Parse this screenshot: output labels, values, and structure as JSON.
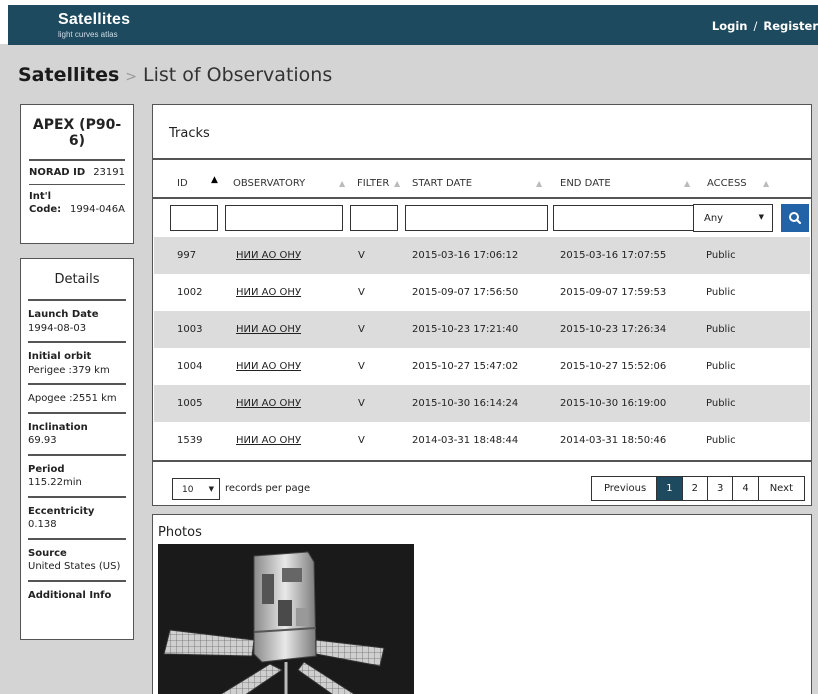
{
  "navbar": {
    "brand_title": "Satellites",
    "brand_subtitle": "light curves atlas",
    "login": "Login",
    "separator": "/",
    "register": "Register"
  },
  "breadcrumb": {
    "root": "Satellites",
    "separator": ">",
    "current": "List of Observations"
  },
  "satellite": {
    "name": "APEX (P90-6)",
    "norad_label": "NORAD ID",
    "norad_value": "23191",
    "intl_label_1": "Int'l",
    "intl_label_2": "Code:",
    "intl_value": "1994-046A"
  },
  "details": {
    "title": "Details",
    "launch_label": "Launch Date",
    "launch_value": "1994-08-03",
    "orbit_label": "Initial orbit",
    "perigee": "Perigee :379 km",
    "apogee": "Apogee :2551 km",
    "inclination_label": "Inclination",
    "inclination_value": "69.93",
    "period_label": "Period",
    "period_value": "115.22min",
    "eccentricity_label": "Eccentricity",
    "eccentricity_value": "0.138",
    "source_label": "Source",
    "source_value": "United States (US)",
    "additional_info": "Additional Info"
  },
  "tracks": {
    "title": "Tracks",
    "columns": {
      "id": "ID",
      "observatory": "OBSERVATORY",
      "filter": "FILTER",
      "start_date": "START DATE",
      "end_date": "END DATE",
      "access": "ACCESS"
    },
    "sorted_column": "ID",
    "access_filter": "Any",
    "rows": [
      {
        "id": "997",
        "observatory": "НИИ АО ОНУ",
        "filter": "V",
        "start": "2015-03-16 17:06:12",
        "end": "2015-03-16 17:07:55",
        "access": "Public"
      },
      {
        "id": "1002",
        "observatory": "НИИ АО ОНУ",
        "filter": "V",
        "start": "2015-09-07 17:56:50",
        "end": "2015-09-07 17:59:53",
        "access": "Public"
      },
      {
        "id": "1003",
        "observatory": "НИИ АО ОНУ",
        "filter": "V",
        "start": "2015-10-23 17:21:40",
        "end": "2015-10-23 17:26:34",
        "access": "Public"
      },
      {
        "id": "1004",
        "observatory": "НИИ АО ОНУ",
        "filter": "V",
        "start": "2015-10-27 15:47:02",
        "end": "2015-10-27 15:52:06",
        "access": "Public"
      },
      {
        "id": "1005",
        "observatory": "НИИ АО ОНУ",
        "filter": "V",
        "start": "2015-10-30 16:14:24",
        "end": "2015-10-30 16:19:00",
        "access": "Public"
      },
      {
        "id": "1539",
        "observatory": "НИИ АО ОНУ",
        "filter": "V",
        "start": "2014-03-31 18:48:44",
        "end": "2014-03-31 18:50:46",
        "access": "Public"
      }
    ],
    "page_length": "10",
    "page_length_label": "records per page",
    "pagination": {
      "previous": "Previous",
      "pages": [
        "1",
        "2",
        "3",
        "4"
      ],
      "active_page": "1",
      "next": "Next"
    }
  },
  "photos": {
    "title": "Photos"
  },
  "colors": {
    "navbar": "#1e4a5f",
    "search_button": "#2262a6",
    "active_page": "#1e4a5f",
    "page_background": "#d4d4d4"
  }
}
